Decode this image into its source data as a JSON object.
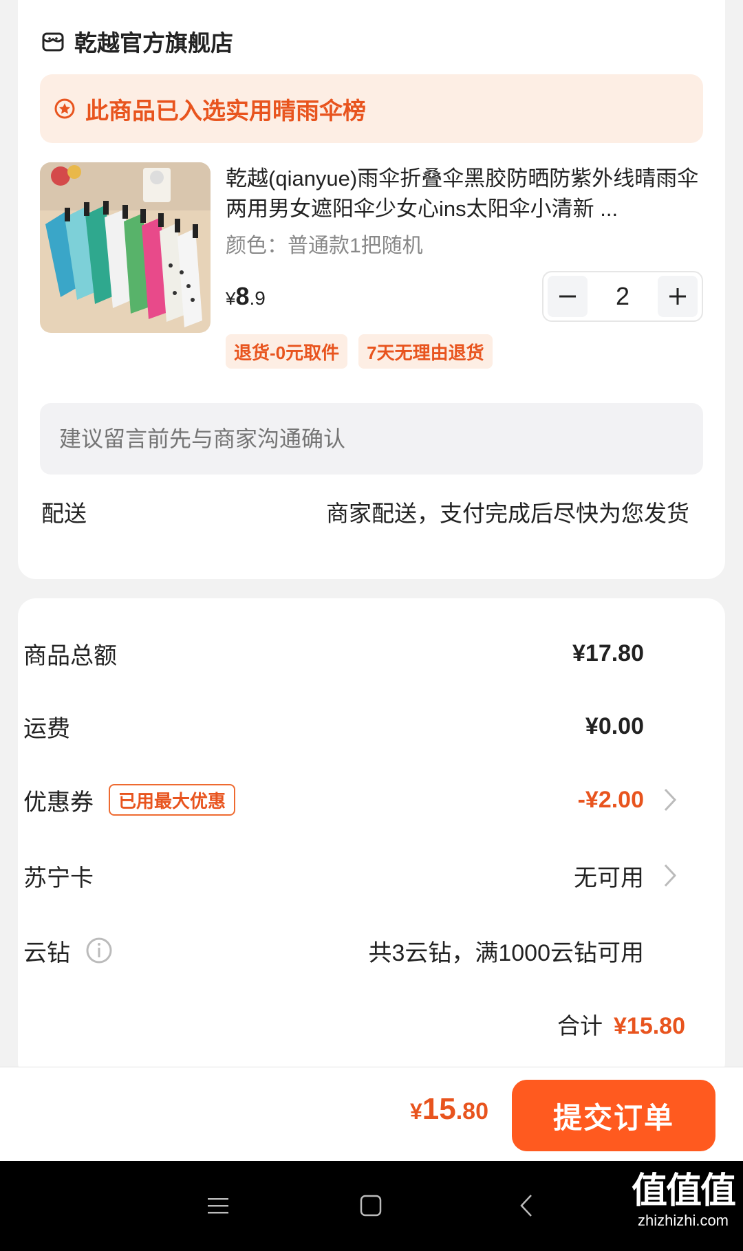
{
  "store": {
    "name": "乾越官方旗舰店",
    "icon": "store-icon"
  },
  "banner": {
    "text": "此商品已入选实用晴雨伞榜",
    "icon": "star-badge-icon"
  },
  "product": {
    "title": "乾越(qianyue)雨伞折叠伞黑胶防晒防紫外线晴雨伞两用男女遮阳伞少女心ins太阳伞小清新 ...",
    "spec": "颜色：普通款1把随机",
    "price_symbol": "¥",
    "price_int": "8",
    "price_dec": ".9",
    "quantity": "2",
    "tags": [
      "退货-0元取件",
      "7天无理由退货"
    ]
  },
  "note": {
    "placeholder": "建议留言前先与商家沟通确认"
  },
  "delivery": {
    "label": "配送",
    "value": "商家配送，支付完成后尽快为您发货"
  },
  "summary": {
    "goods_total_label": "商品总额",
    "goods_total_value": "¥17.80",
    "shipping_label": "运费",
    "shipping_value": "¥0.00",
    "coupon_label": "优惠券",
    "coupon_badge": "已用最大优惠",
    "coupon_value": "-¥2.00",
    "card_label": "苏宁卡",
    "card_value": "无可用",
    "cloud_label": "云钻",
    "cloud_value": "共3云钻，满1000云钻可用",
    "total_label": "合计",
    "total_value": "¥15.80"
  },
  "bottom": {
    "price_symbol": "¥",
    "price_int": "15",
    "price_dec": ".80",
    "submit_label": "提交订单"
  },
  "watermark": {
    "big": "值值值",
    "small": "zhizhizhi.com"
  },
  "colors": {
    "accent": "#ff5a1f",
    "accent_text": "#e8541e",
    "banner_bg": "#fdeee4"
  }
}
